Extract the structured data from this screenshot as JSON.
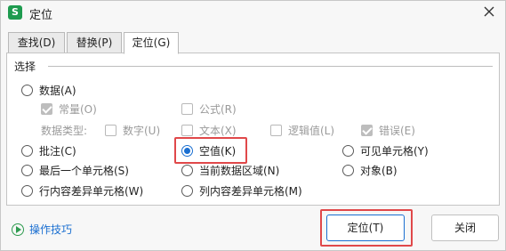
{
  "window": {
    "title": "定位",
    "app_icon_letter": "S"
  },
  "tabs": [
    {
      "label": "查找(D)",
      "active": false
    },
    {
      "label": "替换(P)",
      "active": false
    },
    {
      "label": "定位(G)",
      "active": true
    }
  ],
  "section": {
    "label": "选择"
  },
  "options": {
    "data": {
      "label": "数据(A)",
      "checked": false
    },
    "constants": {
      "label": "常量(O)",
      "checked": true,
      "disabled": true
    },
    "formulas": {
      "label": "公式(R)",
      "checked": false,
      "disabled": true
    },
    "data_type_label": "数据类型:",
    "number": {
      "label": "数字(U)",
      "checked": false,
      "disabled": true
    },
    "text": {
      "label": "文本(X)",
      "checked": false,
      "disabled": true
    },
    "logical": {
      "label": "逻辑值(L)",
      "checked": false,
      "disabled": true
    },
    "error": {
      "label": "错误(E)",
      "checked": true,
      "disabled": true
    },
    "comments": {
      "label": "批注(C)",
      "checked": false
    },
    "blanks": {
      "label": "空值(K)",
      "checked": true
    },
    "visible_cells": {
      "label": "可见单元格(Y)",
      "checked": false
    },
    "last_cell": {
      "label": "最后一个单元格(S)",
      "checked": false
    },
    "current_region": {
      "label": "当前数据区域(N)",
      "checked": false
    },
    "objects": {
      "label": "对象(B)",
      "checked": false
    },
    "row_differences": {
      "label": "行内容差异单元格(W)",
      "checked": false
    },
    "column_differences": {
      "label": "列内容差异单元格(M)",
      "checked": false
    }
  },
  "footer": {
    "tips_label": "操作技巧",
    "go_label": "定位(T)",
    "close_label": "关闭"
  },
  "colors": {
    "accent": "#1a6fd1",
    "highlight": "#e0484a",
    "app_green": "#1e9b4f"
  }
}
